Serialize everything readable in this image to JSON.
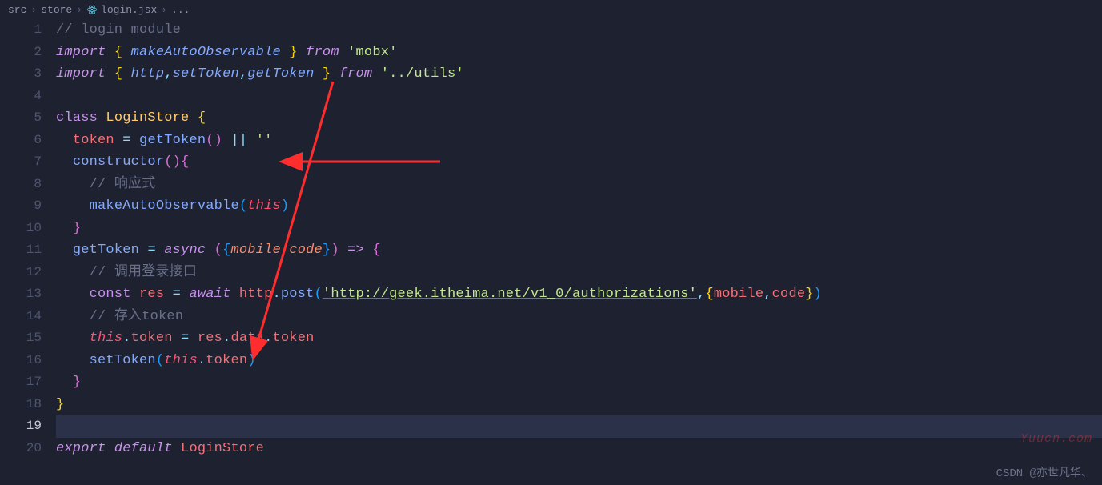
{
  "breadcrumb": {
    "part1": "src",
    "part2": "store",
    "part3": "login.jsx",
    "part4": "..."
  },
  "code": {
    "lines": [
      1,
      2,
      3,
      4,
      5,
      6,
      7,
      8,
      9,
      10,
      11,
      12,
      13,
      14,
      15,
      16,
      17,
      18,
      19,
      20
    ],
    "l1_comment": "// login module",
    "l2": {
      "import": "import",
      "brace_o": "{",
      "name": "makeAutoObservable",
      "brace_c": "}",
      "from": "from",
      "mod": "'mobx'"
    },
    "l3": {
      "import": "import",
      "brace_o": "{",
      "n1": "http",
      "n2": "setToken",
      "n3": "getToken",
      "brace_c": "}",
      "from": "from",
      "mod": "'../utils'"
    },
    "l5": {
      "class": "class",
      "name": "LoginStore",
      "brace": "{"
    },
    "l6": {
      "prop": "token",
      "eq": "=",
      "fn": "getToken",
      "par": "()",
      "or": "||",
      "str": "''"
    },
    "l7": {
      "ctor": "constructor",
      "par": "()",
      "brace": "{"
    },
    "l8_comment": "// 响应式",
    "l9": {
      "fn": "makeAutoObservable",
      "po": "(",
      "this": "this",
      "pc": ")"
    },
    "l10_brace": "}",
    "l11": {
      "prop": "getToken",
      "eq": "=",
      "async": "async",
      "po": "(",
      "bo": "{",
      "p1": "mobile",
      "p2": "code",
      "bc": "}",
      "pc": ")",
      "arrow": "=>",
      "brace": "{"
    },
    "l12_comment": "// 调用登录接口",
    "l13": {
      "const": "const",
      "var": "res",
      "eq": "=",
      "await": "await",
      "obj": "http",
      "dot": ".",
      "fn": "post",
      "po": "(",
      "url": "'http://geek.itheima.net/v1_0/authorizations'",
      "comma": ",",
      "bo": "{",
      "p1": "mobile",
      "p2": "code",
      "bc": "}",
      "pc": ")"
    },
    "l14_comment": "// 存入token",
    "l15": {
      "this": "this",
      "dot": ".",
      "prop": "token",
      "eq": "=",
      "obj": "res",
      "d2": ".",
      "p2": "data",
      "d3": ".",
      "p3": "token"
    },
    "l16": {
      "fn": "setToken",
      "po": "(",
      "this": "this",
      "dot": ".",
      "prop": "token",
      "pc": ")"
    },
    "l17_brace": "}",
    "l18_brace": "}",
    "l20": {
      "export": "export",
      "default": "default",
      "name": "LoginStore"
    }
  },
  "watermark1": "Yuucn.com",
  "watermark2": "CSDN @亦世凡华、"
}
